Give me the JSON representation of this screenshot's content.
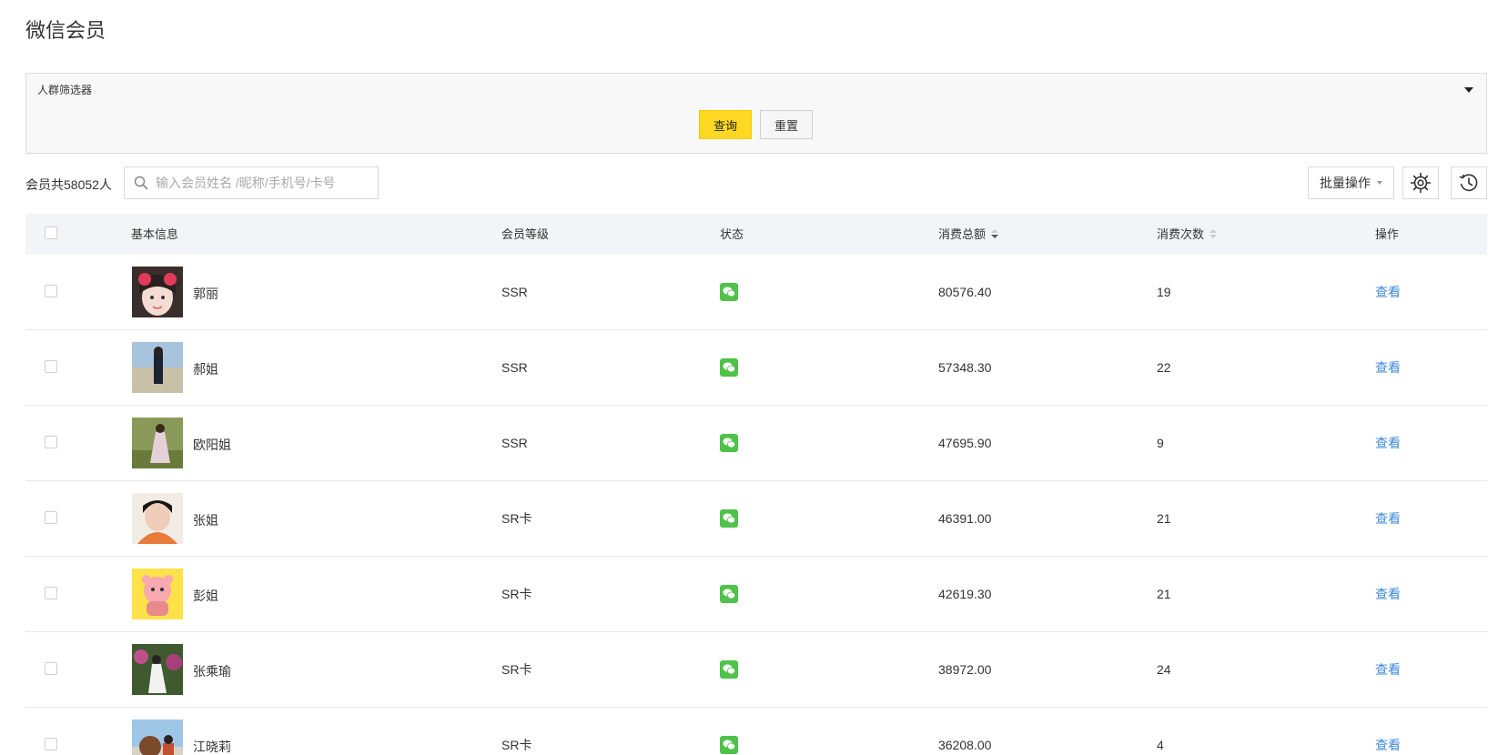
{
  "page": {
    "title": "微信会员"
  },
  "filter": {
    "label": "人群筛选器",
    "query_label": "查询",
    "reset_label": "重置"
  },
  "toolbar": {
    "member_count_text": "会员共58052人",
    "search_placeholder": "输入会员姓名 /昵称/手机号/卡号",
    "bulk_label": "批量操作",
    "settings_icon": "gear-icon",
    "history_icon": "history-icon"
  },
  "colors": {
    "accent": "#ffd823",
    "link": "#3f89d8",
    "wechat": "#4fc24a",
    "header_bg": "#f3f4f7"
  },
  "table": {
    "columns": [
      "基本信息",
      "会员等级",
      "状态",
      "消费总额",
      "消费次数",
      "操作"
    ],
    "rows": [
      {
        "name": "郭丽",
        "level": "SSR",
        "status": "wechat-icon",
        "amount": "80576.40",
        "count": "19",
        "action": "查看"
      },
      {
        "name": "郝姐",
        "level": "SSR",
        "status": "wechat-icon",
        "amount": "57348.30",
        "count": "22",
        "action": "查看"
      },
      {
        "name": "欧阳姐",
        "level": "SSR",
        "status": "wechat-icon",
        "amount": "47695.90",
        "count": "9",
        "action": "查看"
      },
      {
        "name": "张姐",
        "level": "SR卡",
        "status": "wechat-icon",
        "amount": "46391.00",
        "count": "21",
        "action": "查看"
      },
      {
        "name": "彭姐",
        "level": "SR卡",
        "status": "wechat-icon",
        "amount": "42619.30",
        "count": "21",
        "action": "查看"
      },
      {
        "name": "张乘瑜",
        "level": "SR卡",
        "status": "wechat-icon",
        "amount": "38972.00",
        "count": "24",
        "action": "查看"
      },
      {
        "name": "江晓莉",
        "level": "SR卡",
        "status": "wechat-icon",
        "amount": "36208.00",
        "count": "4",
        "action": "查看"
      }
    ]
  }
}
